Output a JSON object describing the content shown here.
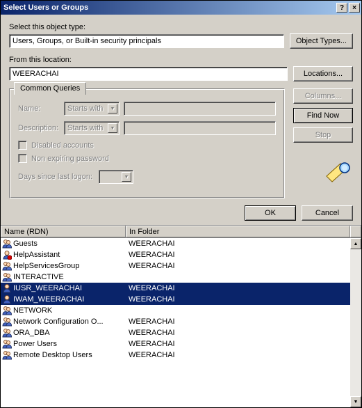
{
  "titlebar": {
    "title": "Select Users or Groups",
    "help": "?",
    "close": "×"
  },
  "labels": {
    "objectType": "Select this object type:",
    "location": "From this location:",
    "commonQueries": "Common Queries",
    "name": "Name:",
    "description": "Description:",
    "disabled": "Disabled accounts",
    "nonExpiring": "Non expiring password",
    "daysSince": "Days since last logon:"
  },
  "fields": {
    "objectTypeValue": "Users, Groups, or Built-in security principals",
    "locationValue": "WEERACHAI",
    "startsWith": "Starts with"
  },
  "buttons": {
    "objectTypes": "Object Types...",
    "locations": "Locations...",
    "columns": "Columns...",
    "findNow": "Find Now",
    "stop": "Stop",
    "ok": "OK",
    "cancel": "Cancel"
  },
  "results": {
    "col1": "Name (RDN)",
    "col2": "In Folder",
    "rows": [
      {
        "name": "Guests",
        "folder": "WEERACHAI",
        "icon": "group",
        "selected": false
      },
      {
        "name": "HelpAssistant",
        "folder": "WEERACHAI",
        "icon": "user-red",
        "selected": false
      },
      {
        "name": "HelpServicesGroup",
        "folder": "WEERACHAI",
        "icon": "group",
        "selected": false
      },
      {
        "name": "INTERACTIVE",
        "folder": "",
        "icon": "group",
        "selected": false
      },
      {
        "name": "IUSR_WEERACHAI",
        "folder": "WEERACHAI",
        "icon": "user",
        "selected": true
      },
      {
        "name": "IWAM_WEERACHAI",
        "folder": "WEERACHAI",
        "icon": "user",
        "selected": true
      },
      {
        "name": "NETWORK",
        "folder": "",
        "icon": "group",
        "selected": false
      },
      {
        "name": "Network Configuration O...",
        "folder": "WEERACHAI",
        "icon": "group",
        "selected": false
      },
      {
        "name": "ORA_DBA",
        "folder": "WEERACHAI",
        "icon": "group",
        "selected": false
      },
      {
        "name": "Power Users",
        "folder": "WEERACHAI",
        "icon": "group",
        "selected": false
      },
      {
        "name": "Remote Desktop Users",
        "folder": "WEERACHAI",
        "icon": "group",
        "selected": false
      }
    ]
  }
}
